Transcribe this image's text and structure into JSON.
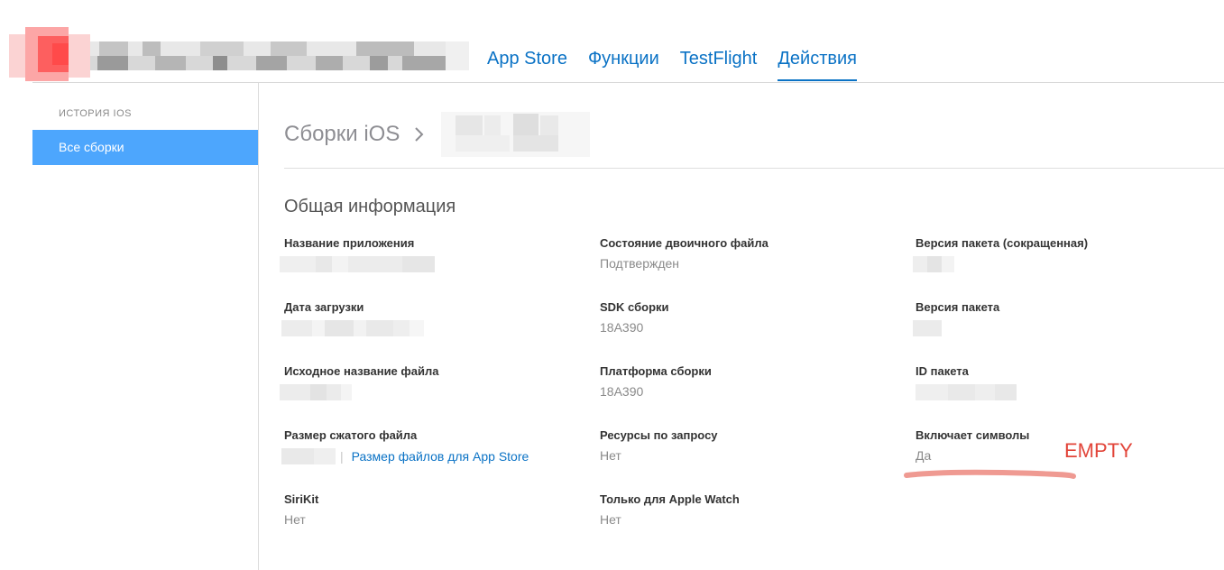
{
  "header": {
    "tabs": [
      {
        "label": "App Store"
      },
      {
        "label": "Функции"
      },
      {
        "label": "TestFlight"
      },
      {
        "label": "Действия"
      }
    ],
    "active_tab": "Действия"
  },
  "sidebar": {
    "heading": "ИСТОРИЯ IOS",
    "items": [
      {
        "label": "Все сборки",
        "selected": true
      }
    ]
  },
  "breadcrumb": {
    "root": "Сборки iOS"
  },
  "section": {
    "title": "Общая информация",
    "fields": {
      "app_name": {
        "label": "Название приложения"
      },
      "binary_state": {
        "label": "Состояние двоичного файла",
        "value": "Подтвержден"
      },
      "bundle_short_version": {
        "label": "Версия пакета (сокращенная)"
      },
      "upload_date": {
        "label": "Дата загрузки"
      },
      "build_sdk": {
        "label": "SDK сборки",
        "value": "18A390"
      },
      "bundle_version": {
        "label": "Версия пакета"
      },
      "original_file_name": {
        "label": "Исходное название файла"
      },
      "build_platform": {
        "label": "Платформа сборки",
        "value": "18A390"
      },
      "bundle_id": {
        "label": "ID пакета"
      },
      "compressed_size": {
        "label": "Размер сжатого файла",
        "pipe": "|",
        "link": "Размер файлов для App Store"
      },
      "on_demand_resources": {
        "label": "Ресурсы по запросу",
        "value": "Нет"
      },
      "includes_symbols": {
        "label": "Включает символы",
        "value": "Да"
      },
      "sirikit": {
        "label": "SiriKit",
        "value": "Нет"
      },
      "watch_only": {
        "label": "Только для Apple Watch",
        "value": "Нет"
      }
    }
  },
  "annotation": {
    "text": "EMPTY",
    "color": "#e2453a"
  },
  "colors": {
    "accent": "#0a72c5",
    "sidebar_selected": "#4da6fd"
  }
}
